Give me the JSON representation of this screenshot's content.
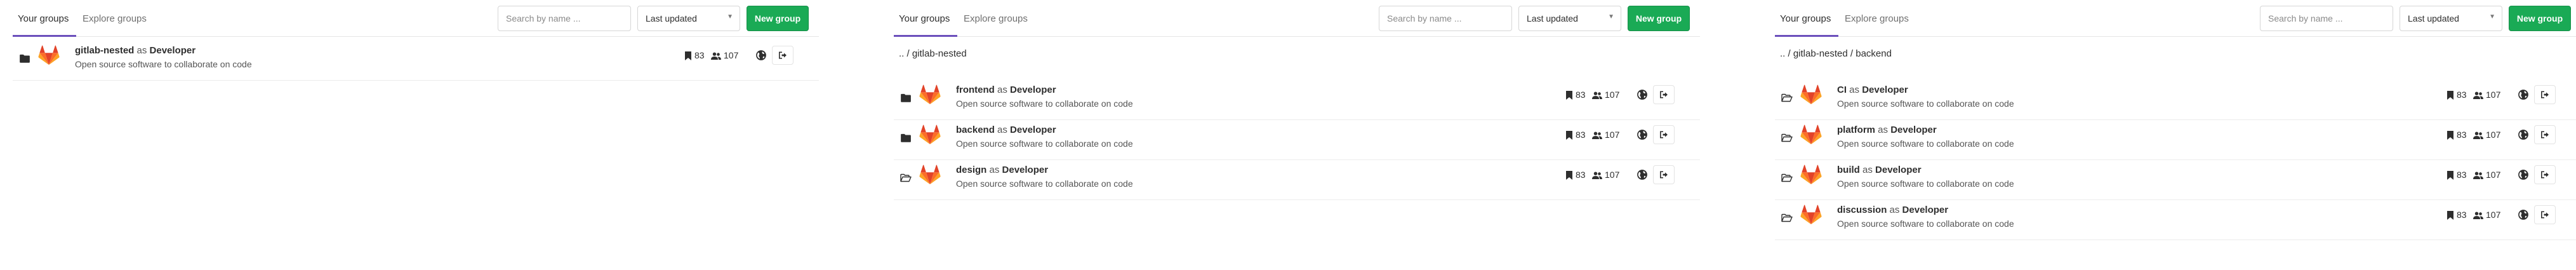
{
  "panels": [
    {
      "tabs": [
        "Your groups",
        "Explore groups"
      ],
      "search_placeholder": "Search by name ...",
      "sort_label": "Last updated",
      "new_group_label": "New group",
      "breadcrumb": "",
      "rows": [
        {
          "name": "gitlab-nested",
          "as_text": "as",
          "role": "Developer",
          "description": "Open source software to collaborate on code",
          "projects": "83",
          "members": "107",
          "folder": "closed"
        }
      ]
    },
    {
      "tabs": [
        "Your groups",
        "Explore groups"
      ],
      "search_placeholder": "Search by name ...",
      "sort_label": "Last updated",
      "new_group_label": "New group",
      "breadcrumb": ".. / gitlab-nested",
      "rows": [
        {
          "name": "frontend",
          "as_text": "as",
          "role": "Developer",
          "description": "Open source software to collaborate on code",
          "projects": "83",
          "members": "107",
          "folder": "closed"
        },
        {
          "name": "backend",
          "as_text": "as",
          "role": "Developer",
          "description": "Open source software to collaborate on code",
          "projects": "83",
          "members": "107",
          "folder": "closed"
        },
        {
          "name": "design",
          "as_text": "as",
          "role": "Developer",
          "description": "Open source software to collaborate on code",
          "projects": "83",
          "members": "107",
          "folder": "open"
        }
      ]
    },
    {
      "tabs": [
        "Your groups",
        "Explore groups"
      ],
      "search_placeholder": "Search by name ...",
      "sort_label": "Last updated",
      "new_group_label": "New group",
      "breadcrumb": ".. / gitlab-nested / backend",
      "rows": [
        {
          "name": "CI",
          "as_text": "as",
          "role": "Developer",
          "description": "Open source software to collaborate on code",
          "projects": "83",
          "members": "107",
          "folder": "open"
        },
        {
          "name": "platform",
          "as_text": "as",
          "role": "Developer",
          "description": "Open source software to collaborate on code",
          "projects": "83",
          "members": "107",
          "folder": "open"
        },
        {
          "name": "build",
          "as_text": "as",
          "role": "Developer",
          "description": "Open source software to collaborate on code",
          "projects": "83",
          "members": "107",
          "folder": "open"
        },
        {
          "name": "discussion",
          "as_text": "as",
          "role": "Developer",
          "description": "Open source software to collaborate on code",
          "projects": "83",
          "members": "107",
          "folder": "open"
        }
      ]
    }
  ],
  "icons": {
    "folder_closed": "folder-icon",
    "folder_open": "folder-open-icon",
    "avatar": "gitlab-tanuki-logo",
    "projects": "bookmark-icon",
    "members": "users-icon",
    "visibility": "globe-icon",
    "leave": "sign-out-icon"
  },
  "colors": {
    "accent": "#6b4fbb",
    "new_group_button": "#1aaa55",
    "tanuki_orange": "#fc6d26",
    "tanuki_red": "#e24329",
    "tanuki_light": "#fca326"
  }
}
